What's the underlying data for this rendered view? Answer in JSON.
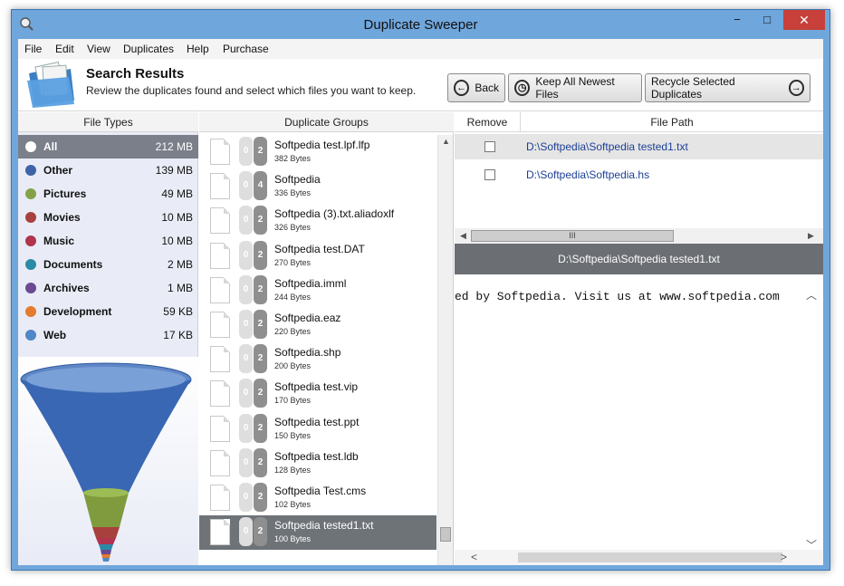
{
  "window": {
    "title": "Duplicate Sweeper",
    "minimize": "−",
    "maximize": "□",
    "close": "✕"
  },
  "menu": [
    "File",
    "Edit",
    "View",
    "Duplicates",
    "Help",
    "Purchase"
  ],
  "header": {
    "title": "Search Results",
    "subtitle": "Review the duplicates found and select which files you want to keep.",
    "back_label": "Back",
    "keep_label": "Keep All Newest Files",
    "recycle_label": "Recycle Selected Duplicates"
  },
  "file_types": {
    "header": "File Types",
    "items": [
      {
        "label": "All",
        "size": "212 MB",
        "color": "#ffffff"
      },
      {
        "label": "Other",
        "size": "139 MB",
        "color": "#3f63a8"
      },
      {
        "label": "Pictures",
        "size": "49 MB",
        "color": "#84a24a"
      },
      {
        "label": "Movies",
        "size": "10 MB",
        "color": "#a8403d"
      },
      {
        "label": "Music",
        "size": "10 MB",
        "color": "#b0344e"
      },
      {
        "label": "Documents",
        "size": "2 MB",
        "color": "#2b8aa6"
      },
      {
        "label": "Archives",
        "size": "1 MB",
        "color": "#6a4a93"
      },
      {
        "label": "Development",
        "size": "59 KB",
        "color": "#e47b2f"
      },
      {
        "label": "Web",
        "size": "17 KB",
        "color": "#4f87c8"
      }
    ]
  },
  "groups": {
    "header": "Duplicate Groups",
    "items": [
      {
        "name": "Softpedia test.lpf.lfp",
        "size": "382 Bytes",
        "a": "0",
        "b": "2"
      },
      {
        "name": "Softpedia",
        "size": "336 Bytes",
        "a": "0",
        "b": "4"
      },
      {
        "name": "Softpedia (3).txt.aliadoxlf",
        "size": "326 Bytes",
        "a": "0",
        "b": "2"
      },
      {
        "name": "Softpedia test.DAT",
        "size": "270 Bytes",
        "a": "0",
        "b": "2"
      },
      {
        "name": "Softpedia.imml",
        "size": "244 Bytes",
        "a": "0",
        "b": "2"
      },
      {
        "name": "Softpedia.eaz",
        "size": "220 Bytes",
        "a": "0",
        "b": "2"
      },
      {
        "name": "Softpedia.shp",
        "size": "200 Bytes",
        "a": "0",
        "b": "2"
      },
      {
        "name": "Softpedia test.vip",
        "size": "170 Bytes",
        "a": "0",
        "b": "2"
      },
      {
        "name": "Softpedia test.ppt",
        "size": "150 Bytes",
        "a": "0",
        "b": "2"
      },
      {
        "name": "Softpedia test.ldb",
        "size": "128 Bytes",
        "a": "0",
        "b": "2"
      },
      {
        "name": "Softpedia Test.cms",
        "size": "102 Bytes",
        "a": "0",
        "b": "2"
      },
      {
        "name": "Softpedia tested1.txt",
        "size": "100 Bytes",
        "a": "0",
        "b": "2"
      }
    ]
  },
  "files": {
    "remove_header": "Remove",
    "path_header": "File Path",
    "items": [
      {
        "path": "D:\\Softpedia\\Softpedia tested1.txt"
      },
      {
        "path": "D:\\Softpedia\\Softpedia.hs"
      }
    ],
    "scroll_grip": "III"
  },
  "preview": {
    "title": "D:\\Softpedia\\Softpedia tested1.txt",
    "text": "ed by Softpedia. Visit us at www.softpedia.com"
  }
}
